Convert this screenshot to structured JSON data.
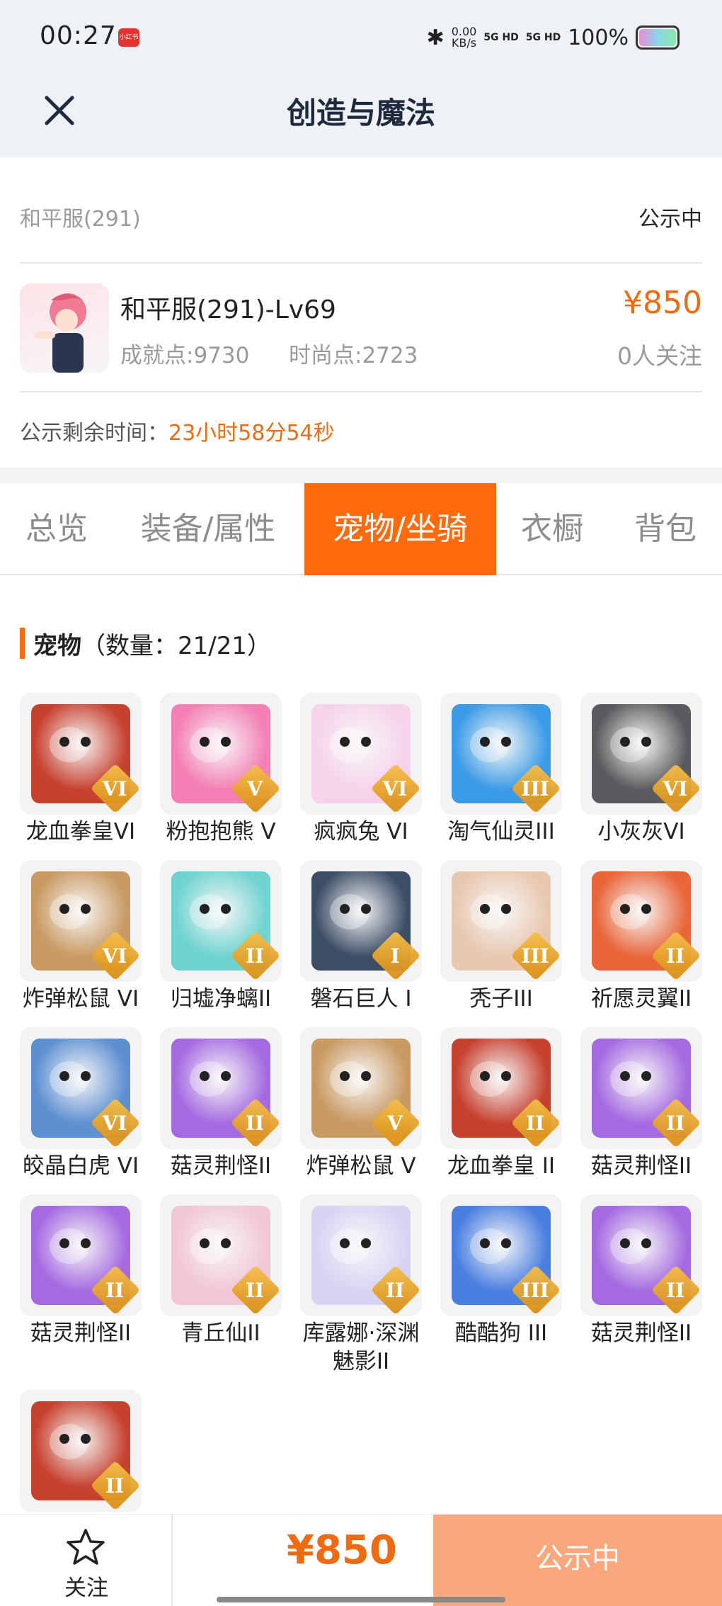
{
  "status_bar": {
    "time": "00:27",
    "app_badge": "小红书",
    "speed_value": "0.00",
    "speed_unit": "KB/s",
    "net1": "5G HD",
    "net2": "5G HD",
    "battery": "100%"
  },
  "header": {
    "title": "创造与魔法"
  },
  "server_row": {
    "server": "和平服(291)",
    "status": "公示中"
  },
  "account": {
    "name": "和平服(291)-Lv69",
    "achievement": "成就点:9730",
    "fashion": "时尚点:2723",
    "price": "¥850",
    "followers": "0人关注"
  },
  "remaining": {
    "label": "公示剩余时间：",
    "value": "23小时58分54秒"
  },
  "tabs": [
    {
      "label": "总览"
    },
    {
      "label": "装备/属性"
    },
    {
      "label": "宠物/坐骑"
    },
    {
      "label": "衣橱"
    },
    {
      "label": "背包"
    }
  ],
  "pets_section": {
    "title": "宠物",
    "count": "（数量：21/21）"
  },
  "pets": [
    {
      "name": "龙血拳皇VI",
      "rank": "VI",
      "color": "#c7412f"
    },
    {
      "name": "粉抱抱熊 V",
      "rank": "V",
      "color": "#f47fb4"
    },
    {
      "name": "疯疯兔 VI",
      "rank": "VI",
      "color": "#f6d3ea"
    },
    {
      "name": "淘气仙灵III",
      "rank": "III",
      "color": "#3c9be6"
    },
    {
      "name": "小灰灰VI",
      "rank": "VI",
      "color": "#5b5b5f"
    },
    {
      "name": "炸弹松鼠 VI",
      "rank": "VI",
      "color": "#c99a62"
    },
    {
      "name": "归墟净螭II",
      "rank": "II",
      "color": "#6fd3d0"
    },
    {
      "name": "磐石巨人 I",
      "rank": "I",
      "color": "#3c4d66"
    },
    {
      "name": "秃子III",
      "rank": "III",
      "color": "#e9c8b0"
    },
    {
      "name": "祈愿灵翼II",
      "rank": "II",
      "color": "#e8663a"
    },
    {
      "name": "皎晶白虎 VI",
      "rank": "VI",
      "color": "#5d8fd1"
    },
    {
      "name": "菇灵荆怪II",
      "rank": "II",
      "color": "#a46ae0"
    },
    {
      "name": "炸弹松鼠 V",
      "rank": "V",
      "color": "#c99a62"
    },
    {
      "name": "龙血拳皇 II",
      "rank": "II",
      "color": "#c7412f"
    },
    {
      "name": "菇灵荆怪II",
      "rank": "II",
      "color": "#a46ae0"
    },
    {
      "name": "菇灵荆怪II",
      "rank": "II",
      "color": "#a46ae0"
    },
    {
      "name": "青丘仙II",
      "rank": "II",
      "color": "#f1c6d6"
    },
    {
      "name": "库露娜·深渊魅影II",
      "rank": "II",
      "color": "#d7d4f3"
    },
    {
      "name": "酷酷狗 III",
      "rank": "III",
      "color": "#4a7fe0"
    },
    {
      "name": "菇灵荆怪II",
      "rank": "II",
      "color": "#a46ae0"
    },
    {
      "name": "",
      "rank": "II",
      "color": "#c7412f"
    }
  ],
  "bottom": {
    "follow_label": "关注",
    "price": "¥850",
    "button_label": "公示中"
  }
}
